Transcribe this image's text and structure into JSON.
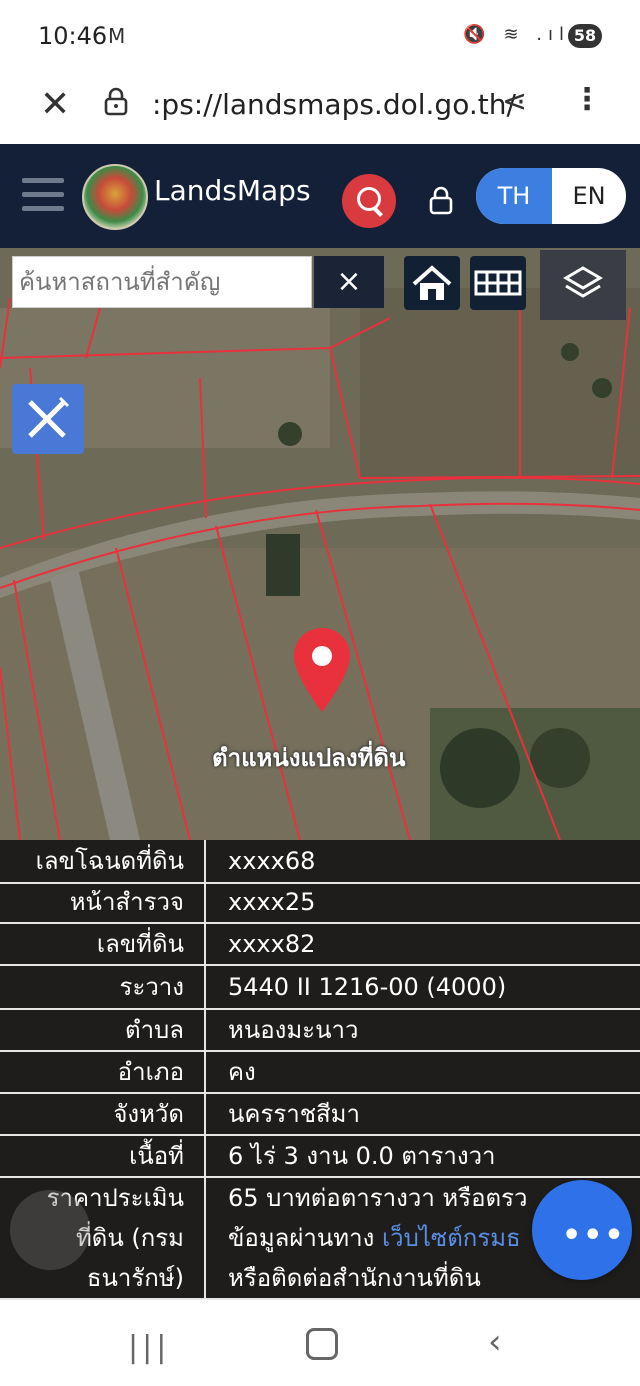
{
  "status_bar": {
    "time": "10:46",
    "mail_icon": "gmail-icon",
    "battery": "58"
  },
  "browser": {
    "url": ":ps://landsmaps.dol.go.th/",
    "close_icon": "close-icon",
    "lock_icon": "lock-icon",
    "share_icon": "share-icon",
    "menu_icon": "more-vert-icon"
  },
  "app_bar": {
    "brand": "LandsMaps",
    "lang_th": "TH",
    "lang_en": "EN"
  },
  "map": {
    "search_placeholder": "ค้นหาสถานที่สำคัญ",
    "clear": "×",
    "pin_label": "ตำแหน่งแปลงที่ดิน",
    "pin_color": "#e8313c"
  },
  "parcel_info": {
    "rows": [
      {
        "key": "เลขโฉนดที่ดิน",
        "value": "xxxx68"
      },
      {
        "key": "หน้าสำรวจ",
        "value": "xxxx25"
      },
      {
        "key": "เลขที่ดิน",
        "value": "xxxx82"
      },
      {
        "key": "ระวาง",
        "value": "5440 II 1216-00 (4000)"
      },
      {
        "key": "ตำบล",
        "value": "หนองมะนาว"
      },
      {
        "key": "อำเภอ",
        "value": "คง"
      },
      {
        "key": "จังหวัด",
        "value": "นครราชสีมา"
      },
      {
        "key": "เนื้อที่",
        "value": "6 ไร่ 3 งาน 0.0 ตารางวา"
      }
    ],
    "price": {
      "key_line1": "ราคาประเมิน",
      "key_line2": "ที่ดิน (กรม",
      "key_line3": "ธนารักษ์)",
      "value_line1": "65 บาทต่อตารางวา หรือตรว",
      "value_line2_prefix": "ข้อมูลผ่านทาง ",
      "value_line2_link": "เว็บไซต์กรมธ",
      "value_line3": "หรือติดต่อสำนักงานที่ดิน"
    }
  },
  "fab_label": "•••",
  "colors": {
    "app_bar": "#132037",
    "accent_blue": "#3d7fe0",
    "search_red": "#d93a3f",
    "parcel_line": "#e8313c"
  }
}
